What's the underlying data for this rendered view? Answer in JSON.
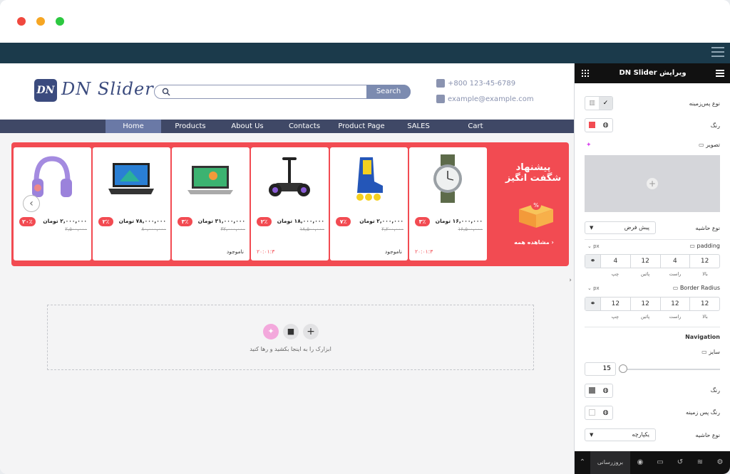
{
  "site": {
    "logo_badge": "DN",
    "logo_text": "DN Slider",
    "search_button": "Search",
    "phone": "+800 123-45-6789",
    "email": "example@example.com",
    "nav": [
      "Home",
      "Products",
      "About Us",
      "Contacts",
      "Product Page",
      "SALES",
      "Cart"
    ]
  },
  "slider": {
    "promo_title": "پیشنهاد شگفت انگیز",
    "see_all": "مشاهده همه",
    "products": [
      {
        "badge": "۳٪",
        "price": "۱۶,۰۰۰,۰۰۰ تومان",
        "old_price": "۱۶,۵۰۰,۰۰۰",
        "footer": "۲۰:۰۱:۳",
        "footer_type": "timer"
      },
      {
        "badge": "۷٪",
        "price": "۲,۰۰۰,۰۰۰ تومان",
        "old_price": "۲,۲۰۰,۰۰۰",
        "footer": "ناموجود",
        "footer_type": "stock"
      },
      {
        "badge": "۲٪",
        "price": "۱۸,۰۰۰,۰۰۰ تومان",
        "old_price": "۱۸,۵۰۰,۰۰۰",
        "footer": "۲۰:۰۱:۳",
        "footer_type": "timer"
      },
      {
        "badge": "۳٪",
        "price": "۳۱,۰۰۰,۰۰۰ تومان",
        "old_price": "۳۲,۰۰۰,۰۰۰",
        "footer": "ناموجود",
        "footer_type": "stock"
      },
      {
        "badge": "۲٪",
        "price": "۷۸,۰۰۰,۰۰۰ تومان",
        "old_price": "۸۰,۰۰۰,۰۰۰",
        "footer": "",
        "footer_type": "none"
      },
      {
        "badge": "۲۰٪",
        "price": "۲,۰۰۰,۰۰۰ تومان",
        "old_price": "۲,۵۰۰,۰۰۰",
        "footer": "",
        "footer_type": "none"
      }
    ]
  },
  "dropzone": {
    "hint": "ابزارک را به اینجا بکشید و رها کنید"
  },
  "panel": {
    "title": "ویرایش DN Slider",
    "bg_type_label": "نوع پس‌زمینه",
    "color_label": "رنگ",
    "image_label": "تصویر",
    "border_type_label": "نوع حاشیه",
    "border_type_value": "پیش فرض",
    "padding_label": "padding",
    "padding_unit": "px",
    "padding": [
      "12",
      "4",
      "12",
      "4"
    ],
    "dim_labels": [
      "بالا",
      "راست",
      "پائین",
      "چپ"
    ],
    "radius_label": "Border Radius",
    "radius_unit": "px",
    "radius": [
      "12",
      "12",
      "12",
      "12"
    ],
    "navigation_label": "Navigation",
    "size_label": "سایز",
    "size_value": "15",
    "nav_color_label": "رنگ",
    "nav_bg_label": "رنگ پس زمینه",
    "nav_border_label": "نوع حاشیه",
    "nav_border_value": "یکپارچه",
    "update_button": "بروزرسانی"
  },
  "colors": {
    "accent_red": "#f24b52",
    "editor_bar": "#1b3a4b",
    "nav_bg": "#3f4866"
  }
}
